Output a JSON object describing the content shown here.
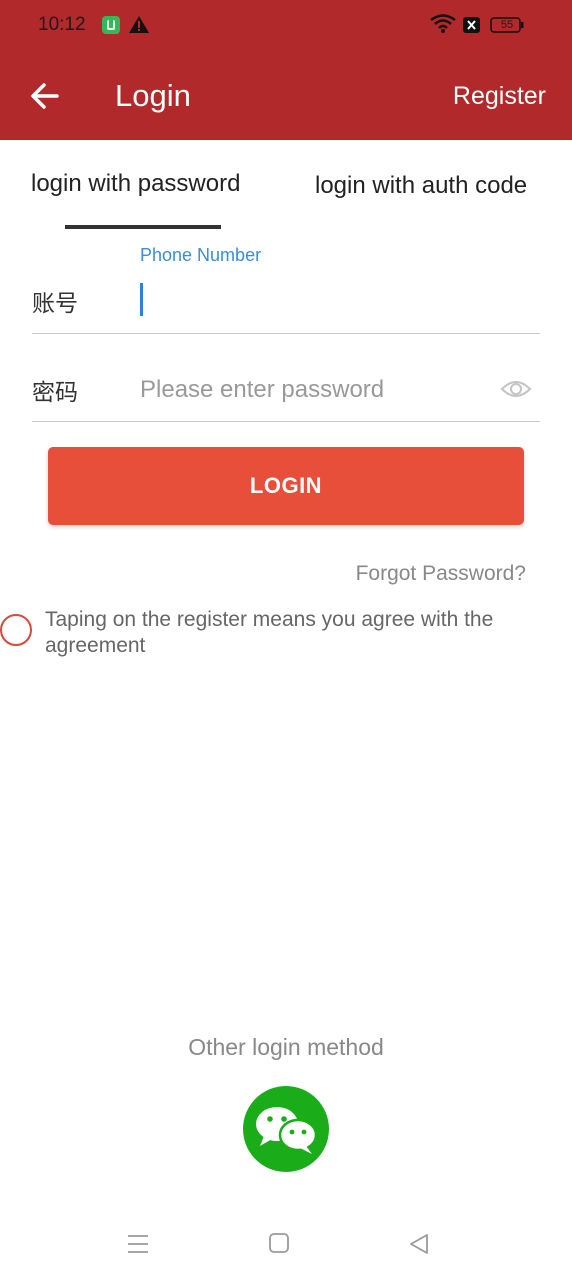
{
  "status_bar": {
    "time": "10:12",
    "battery": "55",
    "icons": [
      "app-icon",
      "warning-icon",
      "wifi-icon",
      "no-sim-icon",
      "battery-icon"
    ]
  },
  "header": {
    "title": "Login",
    "register_label": "Register",
    "back_icon": "arrow-left-icon",
    "background_color": "#b1292a"
  },
  "tabs": [
    {
      "label": "login with password",
      "active": true
    },
    {
      "label": "login with auth code",
      "active": false
    }
  ],
  "form": {
    "account_label": "账号",
    "phone_floating_label": "Phone Number",
    "phone_value": "",
    "password_label": "密码",
    "password_placeholder": "Please enter password",
    "eye_icon": "eye-icon"
  },
  "login_button": {
    "label": "LOGIN",
    "color": "#e74f3b"
  },
  "forgot_password": "Forgot Password?",
  "agreement": {
    "text": "Taping on the register means you agree with the agreement",
    "checked": false
  },
  "other_login": {
    "label": "Other login method",
    "icon": "wechat-icon",
    "color": "#1aad19"
  },
  "nav_bar": {
    "icons": [
      "menu-icon",
      "home-icon",
      "back-triangle-icon"
    ]
  }
}
